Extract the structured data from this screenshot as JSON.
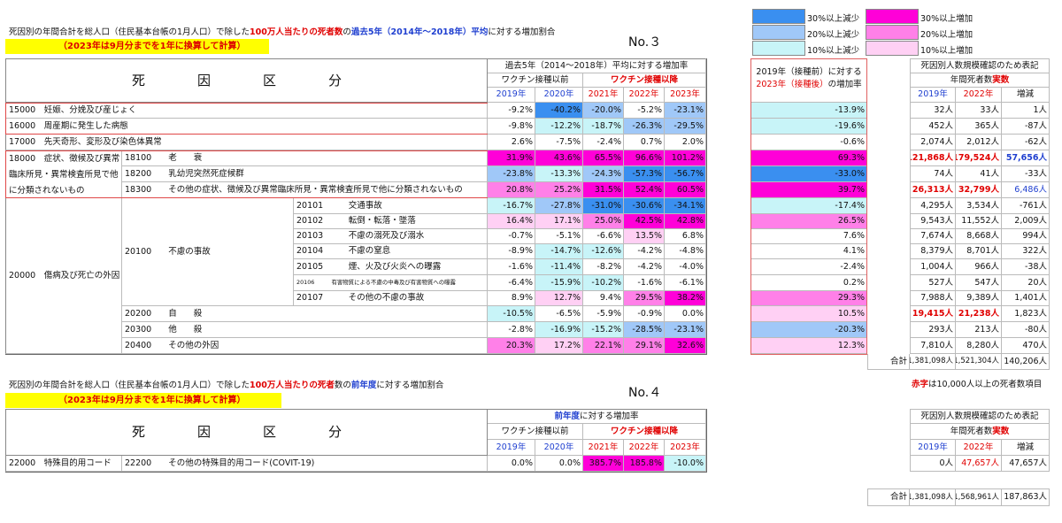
{
  "title1": {
    "prefix": "死因別の年間合計を総人口（住民基本台帳の1月人口）で除した",
    "red": "100万人当たりの死者数",
    "mid": "の",
    "blue": "過去5年（2014年～2018年）平均",
    "suffix": "に対する増加割合"
  },
  "note": "（2023年は9月分までを1年に換算して計算）",
  "no3": "No.３",
  "no4": "No.４",
  "legend": [
    {
      "color": "#3a8ff0",
      "label": "30%以上減少"
    },
    {
      "color": "#a0c8f8",
      "label": "20%以上減少"
    },
    {
      "color": "#c8f4f8",
      "label": "10%以上減少"
    },
    {
      "color": "#ff00d8",
      "label": "30%以上増加"
    },
    {
      "color": "#ff80e8",
      "label": "20%以上増加"
    },
    {
      "color": "#ffd0f4",
      "label": "10%以上増加"
    }
  ],
  "colors": {
    "B3": "#3a8ff0",
    "B2": "#a0c8f8",
    "B1": "#c8f4f8",
    "P3": "#ff00d8",
    "P2": "#ff80e8",
    "P1": "#ffd0f4",
    "red": "#e00000",
    "blue": "#2040d0"
  },
  "t1": {
    "category_header": "死　因　区　分",
    "rate_header": "過去5年（2014～2018年）平均に対する増加率",
    "before": "ワクチン接種以前",
    "after": "ワクチン接種以降",
    "years": [
      "2019年",
      "2020年",
      "2021年",
      "2022年",
      "2023年"
    ],
    "cmp_header1": "2019年（接種前）に対する",
    "cmp_header2_red": "2023年（接種後）",
    "cmp_header2_rest": "の増加率",
    "right_title": "死因別人数規模確認のため表記",
    "right_sub": "年間死者数",
    "right_sub_red": "実数",
    "right_years": [
      "2019年",
      "2022年",
      "増減"
    ],
    "total_label": "合計",
    "total": [
      "1,381,098人",
      "1,521,304人",
      "140,206人"
    ],
    "redtext_note_red": "赤字",
    "redtext_note_rest": "は10,000人以上の死者数項目"
  },
  "t1_labels": {
    "c15000": "15000　妊娠、分娩及び産じょく",
    "c16000": "16000　周産期に発生した病態",
    "c17000": "17000　先天奇形、変形及び染色体異常",
    "c18000": "18000　症状、徴候及び異常臨床所見・異常検査所見で他に分類されないもの",
    "c18100": "18100　　老　　衰",
    "c18200": "18200　　乳幼児突然死症候群",
    "c18300": "18300　　その他の症状、徴候及び異常臨床所見・異常検査所見で他に分類されないもの",
    "c20000": "20000　傷病及び死亡の外因",
    "c20100": "20100　　不慮の事故",
    "c20101": "20101　　　交通事故",
    "c20102": "20102　　　転倒・転落・墜落",
    "c20103": "20103　　　不慮の溺死及び溺水",
    "c20104": "20104　　　不慮の窒息",
    "c20105": "20105　　　煙、火及び火炎への曝露",
    "c20106": "20106　　　有害物質による不慮の中毒及び有害物質への曝露",
    "c20107": "20107　　　その他の不慮の事故",
    "c20200": "20200　　自　　殺",
    "c20300": "20300　　他　　殺",
    "c20400": "20400　　その他の外因"
  },
  "t1_rows": [
    {
      "vals": [
        "-9.2%",
        "-40.2%",
        "-20.0%",
        "-5.2%",
        "-23.1%"
      ],
      "cmp": "-13.9%",
      "n": [
        "32人",
        "33人",
        "1人"
      ]
    },
    {
      "vals": [
        "-9.8%",
        "-12.2%",
        "-18.7%",
        "-26.3%",
        "-29.5%"
      ],
      "cmp": "-19.6%",
      "n": [
        "452人",
        "365人",
        "-87人"
      ]
    },
    {
      "vals": [
        "2.6%",
        "-7.5%",
        "-2.4%",
        "0.7%",
        "2.0%"
      ],
      "cmp": "-0.6%",
      "n": [
        "2,074人",
        "2,012人",
        "-62人"
      ]
    },
    {
      "vals": [
        "31.9%",
        "43.6%",
        "65.5%",
        "96.6%",
        "101.2%"
      ],
      "cmp": "69.3%",
      "n": [
        "121,868人",
        "179,524人",
        "57,656人"
      ]
    },
    {
      "vals": [
        "-23.8%",
        "-13.3%",
        "-24.3%",
        "-57.3%",
        "-56.7%"
      ],
      "cmp": "-33.0%",
      "n": [
        "74人",
        "41人",
        "-33人"
      ]
    },
    {
      "vals": [
        "20.8%",
        "25.2%",
        "31.5%",
        "52.4%",
        "60.5%"
      ],
      "cmp": "39.7%",
      "n": [
        "26,313人",
        "32,799人",
        "6,486人"
      ]
    },
    {
      "vals": [
        "-16.7%",
        "-27.8%",
        "-31.0%",
        "-30.6%",
        "-34.1%"
      ],
      "cmp": "-17.4%",
      "n": [
        "4,295人",
        "3,534人",
        "-761人"
      ]
    },
    {
      "vals": [
        "16.4%",
        "17.1%",
        "25.0%",
        "42.5%",
        "42.8%"
      ],
      "cmp": "26.5%",
      "n": [
        "9,543人",
        "11,552人",
        "2,009人"
      ]
    },
    {
      "vals": [
        "-0.7%",
        "-5.1%",
        "-6.6%",
        "13.5%",
        "6.8%"
      ],
      "cmp": "7.6%",
      "n": [
        "7,674人",
        "8,668人",
        "994人"
      ]
    },
    {
      "vals": [
        "-8.9%",
        "-14.7%",
        "-12.6%",
        "-4.2%",
        "-4.8%"
      ],
      "cmp": "4.1%",
      "n": [
        "8,379人",
        "8,701人",
        "322人"
      ]
    },
    {
      "vals": [
        "-1.6%",
        "-11.4%",
        "-8.2%",
        "-4.2%",
        "-4.0%"
      ],
      "cmp": "-2.4%",
      "n": [
        "1,004人",
        "966人",
        "-38人"
      ]
    },
    {
      "vals": [
        "-6.4%",
        "-15.9%",
        "-10.2%",
        "-1.6%",
        "-6.1%"
      ],
      "cmp": "0.2%",
      "n": [
        "527人",
        "547人",
        "20人"
      ]
    },
    {
      "vals": [
        "8.9%",
        "12.7%",
        "9.4%",
        "29.5%",
        "38.2%"
      ],
      "cmp": "29.3%",
      "n": [
        "7,988人",
        "9,389人",
        "1,401人"
      ]
    },
    {
      "vals": [
        "-10.5%",
        "-6.5%",
        "-5.9%",
        "-0.9%",
        "0.0%"
      ],
      "cmp": "10.5%",
      "n": [
        "19,415人",
        "21,238人",
        "1,823人"
      ]
    },
    {
      "vals": [
        "-2.8%",
        "-16.9%",
        "-15.2%",
        "-28.5%",
        "-23.1%"
      ],
      "cmp": "-20.3%",
      "n": [
        "293人",
        "213人",
        "-80人"
      ]
    },
    {
      "vals": [
        "20.3%",
        "17.2%",
        "22.1%",
        "29.1%",
        "32.6%"
      ],
      "cmp": "12.3%",
      "n": [
        "7,810人",
        "8,280人",
        "470人"
      ]
    }
  ],
  "title2": {
    "prefix": "死因別の年間合計を総人口（住民基本台帳の1月人口）で除した",
    "red": "100万人当たりの死者",
    "mid": "数の",
    "blue": "前年度",
    "suffix": "に対する増加割合"
  },
  "t2": {
    "category_header": "死　因　区　分",
    "rate_header_blue": "前年度",
    "rate_header_rest": "に対する増加率",
    "before": "ワクチン接種以前",
    "after": "ワクチン接種以降",
    "years": [
      "2019年",
      "2020年",
      "2021年",
      "2022年",
      "2023年"
    ],
    "row_code": "22000　特殊目的用コード",
    "row_sub": "22200　　その他の特殊目的用コード(COVIT-19)",
    "vals": [
      "0.0%",
      "0.0%",
      "385.7%",
      "185.8%",
      "-10.0%"
    ],
    "right_title": "死因別人数規模確認のため表記",
    "right_sub": "年間死者数",
    "right_sub_red": "実数",
    "right_years": [
      "2019年",
      "2022年",
      "増減"
    ],
    "n": [
      "0人",
      "47,657人",
      "47,657人"
    ],
    "total_label": "合計",
    "total": [
      "1,381,098人",
      "1,568,961人",
      "187,863人"
    ]
  }
}
